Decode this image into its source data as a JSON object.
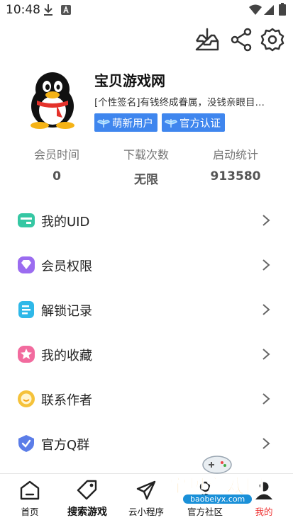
{
  "status_bar": {
    "time": "10:48"
  },
  "profile": {
    "username": "宝贝游戏网",
    "signature": "[个性签名]有钱终成眷属，没钱亲眼目…",
    "badges": [
      "萌新用户",
      "官方认证"
    ]
  },
  "stats": [
    {
      "label": "会员时间",
      "value": "0"
    },
    {
      "label": "下载次数",
      "value": "无限"
    },
    {
      "label": "启动统计",
      "value": "913580"
    }
  ],
  "menu": [
    {
      "label": "我的UID",
      "icon": "card-icon",
      "color": "#35c7a3"
    },
    {
      "label": "会员权限",
      "icon": "diamond-icon",
      "color": "#9b6cf0"
    },
    {
      "label": "解锁记录",
      "icon": "document-icon",
      "color": "#2fb8e8"
    },
    {
      "label": "我的收藏",
      "icon": "star-icon",
      "color": "#f26b9e"
    },
    {
      "label": "联系作者",
      "icon": "smile-icon",
      "color": "#f5c23a"
    },
    {
      "label": "官方Q群",
      "icon": "shield-check-icon",
      "color": "#5b7de8"
    }
  ],
  "bottom_nav": [
    {
      "label": "首页",
      "icon": "home-icon"
    },
    {
      "label": "搜索游戏",
      "icon": "tag-icon"
    },
    {
      "label": "云小程序",
      "icon": "paper-plane-icon"
    },
    {
      "label": "官方社区",
      "icon": "community-icon"
    },
    {
      "label": "我的",
      "icon": "user-icon",
      "active": true
    }
  ],
  "watermark": {
    "title": "宝贝游戏网",
    "url": "baobeiyx.com"
  },
  "colors": {
    "badge": "#3f86ee",
    "active_nav": "#ee3333"
  }
}
